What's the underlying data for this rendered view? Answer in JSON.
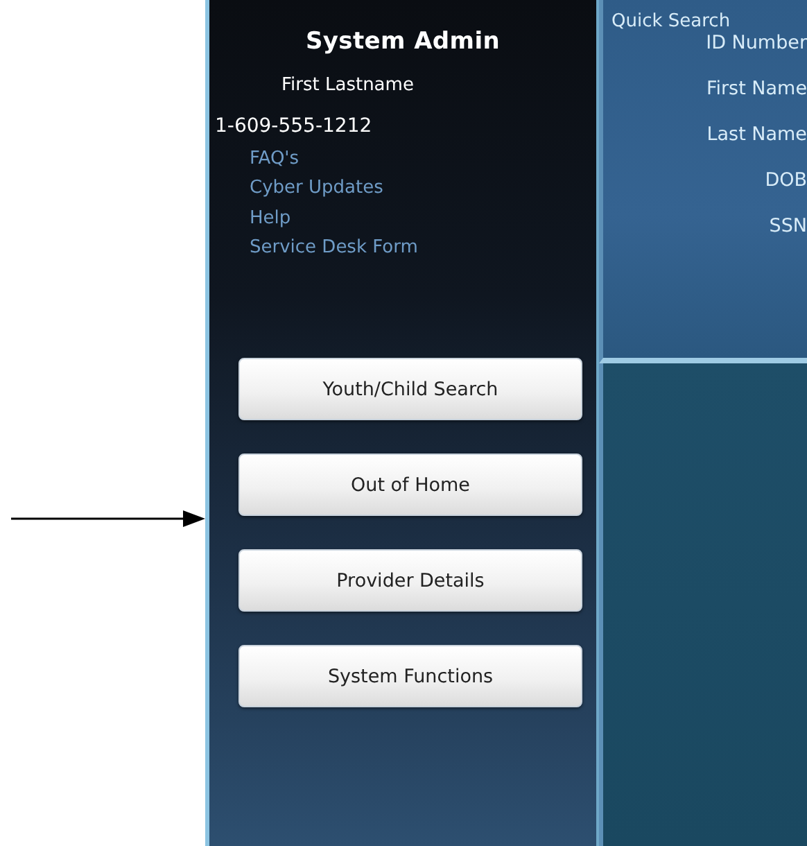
{
  "sidebar": {
    "title": "System Admin",
    "user_name": "First Lastname",
    "phone": "1-609-555-1212",
    "links": [
      "FAQ's",
      "Cyber Updates",
      "Help",
      "Service Desk Form"
    ],
    "buttons": [
      "Youth/Child Search",
      "Out of Home",
      "Provider Details",
      "System Functions"
    ]
  },
  "quick_search": {
    "title": "Quick Search",
    "fields": [
      "ID Number",
      "First Name",
      "Last Name",
      "DOB",
      "SSN"
    ]
  }
}
